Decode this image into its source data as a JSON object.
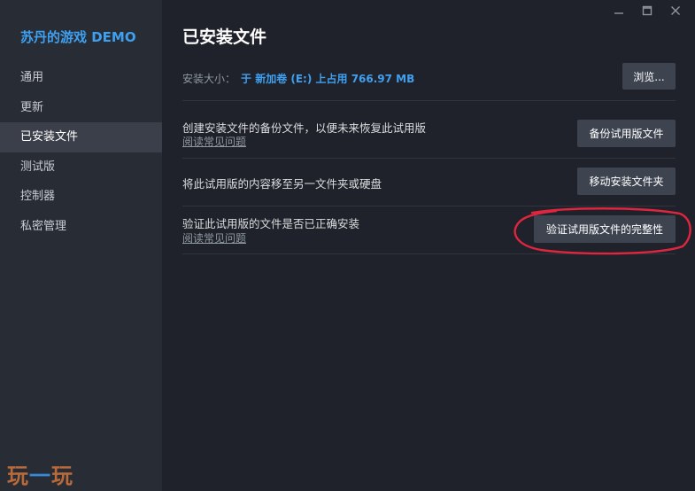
{
  "sidebar": {
    "app_title": "苏丹的游戏 DEMO",
    "items": [
      {
        "label": "通用",
        "active": false
      },
      {
        "label": "更新",
        "active": false
      },
      {
        "label": "已安装文件",
        "active": true
      },
      {
        "label": "测试版",
        "active": false
      },
      {
        "label": "控制器",
        "active": false
      },
      {
        "label": "私密管理",
        "active": false
      }
    ]
  },
  "watermark": {
    "left": "玩",
    "mid": "一",
    "right": "玩"
  },
  "window": {
    "minimize_glyph": "—",
    "maximize_glyph": "☐",
    "close_glyph": "✕"
  },
  "main": {
    "title": "已安装文件",
    "size_label": "安装大小：",
    "size_value": "于 新加卷 (E:) 上占用 766.97 MB",
    "browse_label": "浏览...",
    "rows": [
      {
        "text": "创建安装文件的备份文件，以便未来恢复此试用版",
        "link": "阅读常见问题",
        "button": "备份试用版文件"
      },
      {
        "text": "将此试用版的内容移至另一文件夹或硬盘",
        "link": "",
        "button": "移动安装文件夹"
      },
      {
        "text": "验证此试用版的文件是否已正确安装",
        "link": "阅读常见问题",
        "button": "验证试用版文件的完整性"
      }
    ]
  },
  "colors": {
    "accent": "#3fa0f0",
    "annotation": "#e0253f"
  }
}
